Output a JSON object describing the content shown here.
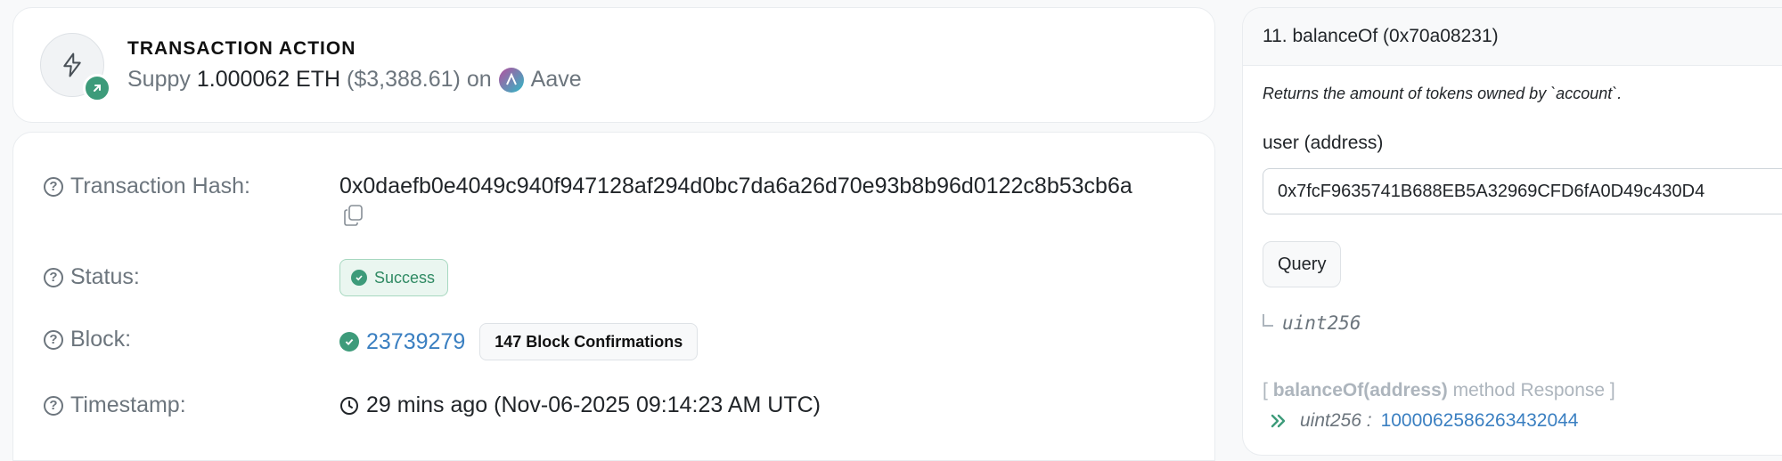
{
  "action": {
    "title": "TRANSACTION ACTION",
    "verb": "Suppy",
    "amount": "1.000062 ETH",
    "usd": "($3,388.61)",
    "on": "on",
    "protocol": "Aave"
  },
  "details": {
    "tx_hash_label": "Transaction Hash:",
    "tx_hash": "0x0daefb0e4049c940f947128af294d0bc7da6a26d70e93b8b96d0122c8b53cb6a",
    "status_label": "Status:",
    "status": "Success",
    "block_label": "Block:",
    "block": "23739279",
    "confirmations": "147 Block Confirmations",
    "timestamp_label": "Timestamp:",
    "timestamp": "29 mins ago (Nov-06-2025 09:14:23 AM UTC)"
  },
  "read": {
    "title": "11. balanceOf (0x70a08231)",
    "description": "Returns the amount of tokens owned by `account`.",
    "param_label": "user (address)",
    "param_value": "0x7fcF9635741B688EB5A32969CFD6fA0D49c430D4",
    "query_label": "Query",
    "return_type": "uint256",
    "response_open": "[",
    "response_method": "balanceOf(address)",
    "response_suffix": "method Response ]",
    "response_type": "uint256 :",
    "response_value": "1000062586263432044"
  },
  "colors": {
    "success": "#3d9b7a",
    "link": "#3a7fc1",
    "muted": "#6c757d"
  }
}
